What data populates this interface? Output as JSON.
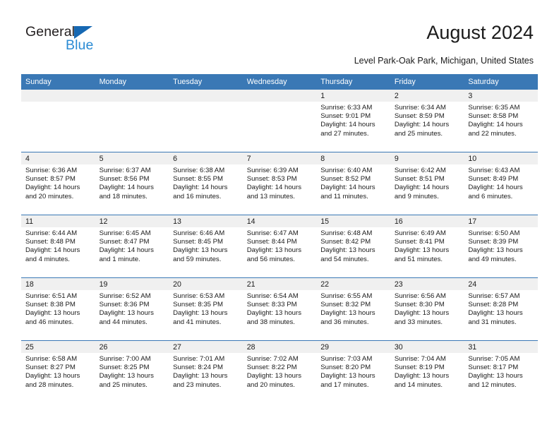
{
  "brand": {
    "word1": "General",
    "word2": "Blue",
    "triangle_color": "#1668b3",
    "blue_color": "#2b8bd4"
  },
  "header": {
    "title": "August 2024",
    "subtitle": "Level Park-Oak Park, Michigan, United States"
  },
  "theme": {
    "header_row_bg": "#3a78b5",
    "daynum_band_bg": "#f0f0f0",
    "grid_line": "#3a78b5",
    "text": "#1a1a1a"
  },
  "columns": [
    "Sunday",
    "Monday",
    "Tuesday",
    "Wednesday",
    "Thursday",
    "Friday",
    "Saturday"
  ],
  "weeks": [
    [
      {
        "day": "",
        "empty": true
      },
      {
        "day": "",
        "empty": true
      },
      {
        "day": "",
        "empty": true
      },
      {
        "day": "",
        "empty": true
      },
      {
        "day": "1",
        "sunrise": "Sunrise: 6:33 AM",
        "sunset": "Sunset: 9:01 PM",
        "daylight1": "Daylight: 14 hours",
        "daylight2": "and 27 minutes."
      },
      {
        "day": "2",
        "sunrise": "Sunrise: 6:34 AM",
        "sunset": "Sunset: 8:59 PM",
        "daylight1": "Daylight: 14 hours",
        "daylight2": "and 25 minutes."
      },
      {
        "day": "3",
        "sunrise": "Sunrise: 6:35 AM",
        "sunset": "Sunset: 8:58 PM",
        "daylight1": "Daylight: 14 hours",
        "daylight2": "and 22 minutes."
      }
    ],
    [
      {
        "day": "4",
        "sunrise": "Sunrise: 6:36 AM",
        "sunset": "Sunset: 8:57 PM",
        "daylight1": "Daylight: 14 hours",
        "daylight2": "and 20 minutes."
      },
      {
        "day": "5",
        "sunrise": "Sunrise: 6:37 AM",
        "sunset": "Sunset: 8:56 PM",
        "daylight1": "Daylight: 14 hours",
        "daylight2": "and 18 minutes."
      },
      {
        "day": "6",
        "sunrise": "Sunrise: 6:38 AM",
        "sunset": "Sunset: 8:55 PM",
        "daylight1": "Daylight: 14 hours",
        "daylight2": "and 16 minutes."
      },
      {
        "day": "7",
        "sunrise": "Sunrise: 6:39 AM",
        "sunset": "Sunset: 8:53 PM",
        "daylight1": "Daylight: 14 hours",
        "daylight2": "and 13 minutes."
      },
      {
        "day": "8",
        "sunrise": "Sunrise: 6:40 AM",
        "sunset": "Sunset: 8:52 PM",
        "daylight1": "Daylight: 14 hours",
        "daylight2": "and 11 minutes."
      },
      {
        "day": "9",
        "sunrise": "Sunrise: 6:42 AM",
        "sunset": "Sunset: 8:51 PM",
        "daylight1": "Daylight: 14 hours",
        "daylight2": "and 9 minutes."
      },
      {
        "day": "10",
        "sunrise": "Sunrise: 6:43 AM",
        "sunset": "Sunset: 8:49 PM",
        "daylight1": "Daylight: 14 hours",
        "daylight2": "and 6 minutes."
      }
    ],
    [
      {
        "day": "11",
        "sunrise": "Sunrise: 6:44 AM",
        "sunset": "Sunset: 8:48 PM",
        "daylight1": "Daylight: 14 hours",
        "daylight2": "and 4 minutes."
      },
      {
        "day": "12",
        "sunrise": "Sunrise: 6:45 AM",
        "sunset": "Sunset: 8:47 PM",
        "daylight1": "Daylight: 14 hours",
        "daylight2": "and 1 minute."
      },
      {
        "day": "13",
        "sunrise": "Sunrise: 6:46 AM",
        "sunset": "Sunset: 8:45 PM",
        "daylight1": "Daylight: 13 hours",
        "daylight2": "and 59 minutes."
      },
      {
        "day": "14",
        "sunrise": "Sunrise: 6:47 AM",
        "sunset": "Sunset: 8:44 PM",
        "daylight1": "Daylight: 13 hours",
        "daylight2": "and 56 minutes."
      },
      {
        "day": "15",
        "sunrise": "Sunrise: 6:48 AM",
        "sunset": "Sunset: 8:42 PM",
        "daylight1": "Daylight: 13 hours",
        "daylight2": "and 54 minutes."
      },
      {
        "day": "16",
        "sunrise": "Sunrise: 6:49 AM",
        "sunset": "Sunset: 8:41 PM",
        "daylight1": "Daylight: 13 hours",
        "daylight2": "and 51 minutes."
      },
      {
        "day": "17",
        "sunrise": "Sunrise: 6:50 AM",
        "sunset": "Sunset: 8:39 PM",
        "daylight1": "Daylight: 13 hours",
        "daylight2": "and 49 minutes."
      }
    ],
    [
      {
        "day": "18",
        "sunrise": "Sunrise: 6:51 AM",
        "sunset": "Sunset: 8:38 PM",
        "daylight1": "Daylight: 13 hours",
        "daylight2": "and 46 minutes."
      },
      {
        "day": "19",
        "sunrise": "Sunrise: 6:52 AM",
        "sunset": "Sunset: 8:36 PM",
        "daylight1": "Daylight: 13 hours",
        "daylight2": "and 44 minutes."
      },
      {
        "day": "20",
        "sunrise": "Sunrise: 6:53 AM",
        "sunset": "Sunset: 8:35 PM",
        "daylight1": "Daylight: 13 hours",
        "daylight2": "and 41 minutes."
      },
      {
        "day": "21",
        "sunrise": "Sunrise: 6:54 AM",
        "sunset": "Sunset: 8:33 PM",
        "daylight1": "Daylight: 13 hours",
        "daylight2": "and 38 minutes."
      },
      {
        "day": "22",
        "sunrise": "Sunrise: 6:55 AM",
        "sunset": "Sunset: 8:32 PM",
        "daylight1": "Daylight: 13 hours",
        "daylight2": "and 36 minutes."
      },
      {
        "day": "23",
        "sunrise": "Sunrise: 6:56 AM",
        "sunset": "Sunset: 8:30 PM",
        "daylight1": "Daylight: 13 hours",
        "daylight2": "and 33 minutes."
      },
      {
        "day": "24",
        "sunrise": "Sunrise: 6:57 AM",
        "sunset": "Sunset: 8:28 PM",
        "daylight1": "Daylight: 13 hours",
        "daylight2": "and 31 minutes."
      }
    ],
    [
      {
        "day": "25",
        "sunrise": "Sunrise: 6:58 AM",
        "sunset": "Sunset: 8:27 PM",
        "daylight1": "Daylight: 13 hours",
        "daylight2": "and 28 minutes."
      },
      {
        "day": "26",
        "sunrise": "Sunrise: 7:00 AM",
        "sunset": "Sunset: 8:25 PM",
        "daylight1": "Daylight: 13 hours",
        "daylight2": "and 25 minutes."
      },
      {
        "day": "27",
        "sunrise": "Sunrise: 7:01 AM",
        "sunset": "Sunset: 8:24 PM",
        "daylight1": "Daylight: 13 hours",
        "daylight2": "and 23 minutes."
      },
      {
        "day": "28",
        "sunrise": "Sunrise: 7:02 AM",
        "sunset": "Sunset: 8:22 PM",
        "daylight1": "Daylight: 13 hours",
        "daylight2": "and 20 minutes."
      },
      {
        "day": "29",
        "sunrise": "Sunrise: 7:03 AM",
        "sunset": "Sunset: 8:20 PM",
        "daylight1": "Daylight: 13 hours",
        "daylight2": "and 17 minutes."
      },
      {
        "day": "30",
        "sunrise": "Sunrise: 7:04 AM",
        "sunset": "Sunset: 8:19 PM",
        "daylight1": "Daylight: 13 hours",
        "daylight2": "and 14 minutes."
      },
      {
        "day": "31",
        "sunrise": "Sunrise: 7:05 AM",
        "sunset": "Sunset: 8:17 PM",
        "daylight1": "Daylight: 13 hours",
        "daylight2": "and 12 minutes."
      }
    ]
  ]
}
